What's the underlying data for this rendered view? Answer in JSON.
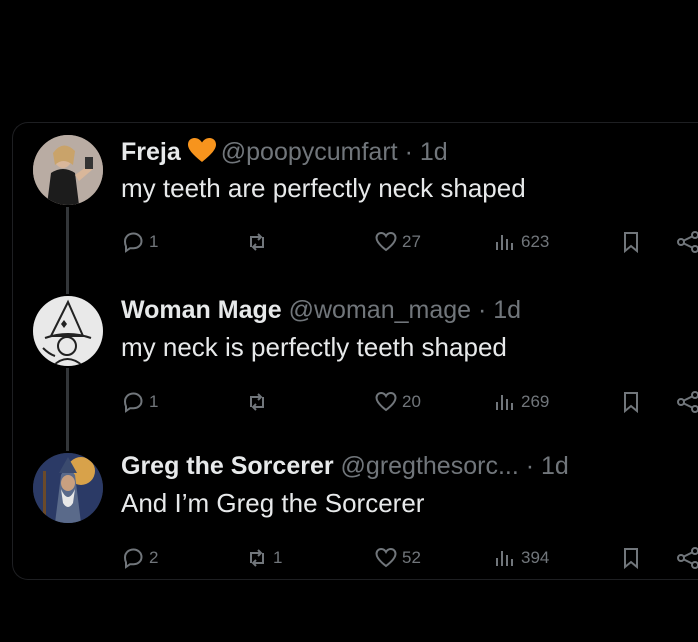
{
  "tweets": [
    {
      "name": "Freja",
      "handle": "@poopycumfart",
      "time": "· 1d",
      "text": "my teeth are perfectly neck shaped",
      "replies": "1",
      "reposts": "",
      "likes": "27",
      "views": "623",
      "badge_color": "#f7941d"
    },
    {
      "name": "Woman Mage",
      "handle": "@woman_mage",
      "time": "· 1d",
      "text": "my neck is perfectly teeth shaped",
      "replies": "1",
      "reposts": "",
      "likes": "20",
      "views": "269"
    },
    {
      "name": "Greg the Sorcerer",
      "handle": "@gregthesorc...",
      "time": "· 1d",
      "text": "And I’m Greg the Sorcerer",
      "replies": "2",
      "reposts": "1",
      "likes": "52",
      "views": "394"
    }
  ],
  "icons": {
    "reply": "reply-icon",
    "repost": "repost-icon",
    "like": "heart-icon",
    "views": "views-icon",
    "bookmark": "bookmark-icon",
    "share": "share-icon"
  },
  "colors": {
    "background": "#000000",
    "text": "#e7e9ea",
    "muted": "#71767b"
  }
}
